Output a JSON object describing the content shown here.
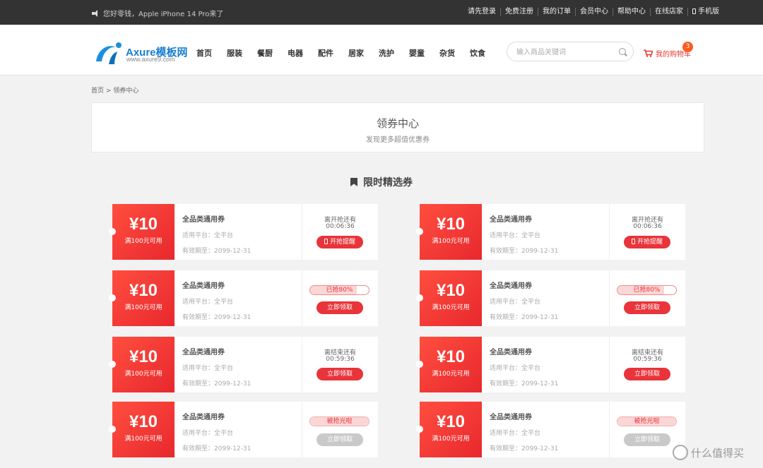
{
  "topbar": {
    "notice": "您好零钱，Apple iPhone 14 Pro来了",
    "links": [
      "请先登录",
      "免费注册",
      "我的订单",
      "会员中心",
      "帮助中心",
      "在线店家",
      "手机版"
    ]
  },
  "header": {
    "logo_text": "Axure模板网",
    "logo_url": "www.axure9.com",
    "nav": [
      "首页",
      "服装",
      "餐厨",
      "电器",
      "配件",
      "居家",
      "洗护",
      "婴童",
      "杂货",
      "饮食"
    ],
    "search_placeholder": "输入商品关键词",
    "cart_label": "我的购物车",
    "cart_count": "3"
  },
  "breadcrumb": {
    "home": "首页",
    "sep": ">",
    "current": "领券中心"
  },
  "title": {
    "main": "领券中心",
    "sub": "发现更多超值优惠券"
  },
  "section_title": "限时精选券",
  "coupons": [
    {
      "amount": "¥10",
      "condition": "满100元可用",
      "name": "全品类通用券",
      "platform": "适用平台：全平台",
      "expiry": "有效期至：2099-12-31",
      "label": "离开抢还有",
      "time": "00:06:36",
      "button": "开抢提醒"
    },
    {
      "amount": "¥10",
      "condition": "满100元可用",
      "name": "全品类通用券",
      "platform": "适用平台：全平台",
      "expiry": "有效期至：2099-12-31",
      "label": "离开抢还有",
      "time": "00:06:36",
      "button": "开抢提醒"
    },
    {
      "amount": "¥10",
      "condition": "满100元可用",
      "name": "全品类通用券",
      "platform": "适用平台：全平台",
      "expiry": "有效期至：2099-12-31",
      "progress": "已抢80%",
      "progress_value": 0.8,
      "button": "立即领取"
    },
    {
      "amount": "¥10",
      "condition": "满100元可用",
      "name": "全品类通用券",
      "platform": "适用平台：全平台",
      "expiry": "有效期至：2099-12-31",
      "progress": "已抢80%",
      "progress_value": 0.8,
      "button": "立即领取"
    },
    {
      "amount": "¥10",
      "condition": "满100元可用",
      "name": "全品类通用券",
      "platform": "适用平台：全平台",
      "expiry": "有效期至：2099-12-31",
      "label": "离结束还有",
      "time": "00:59:36",
      "button": "立即领取"
    },
    {
      "amount": "¥10",
      "condition": "满100元可用",
      "name": "全品类通用券",
      "platform": "适用平台：全平台",
      "expiry": "有效期至：2099-12-31",
      "label": "离结束还有",
      "time": "00:59:36",
      "button": "立即领取"
    },
    {
      "amount": "¥10",
      "condition": "满100元可用",
      "name": "全品类通用券",
      "platform": "适用平台：全平台",
      "expiry": "有效期至：2099-12-31",
      "progress": "被抢光啦",
      "progress_value": 1.0,
      "button": "立即领取"
    },
    {
      "amount": "¥10",
      "condition": "满100元可用",
      "name": "全品类通用券",
      "platform": "适用平台：全平台",
      "expiry": "有效期至：2099-12-31",
      "progress": "被抢光啦",
      "progress_value": 1.0,
      "button": "立即领取"
    }
  ],
  "watermark": "什么值得买"
}
